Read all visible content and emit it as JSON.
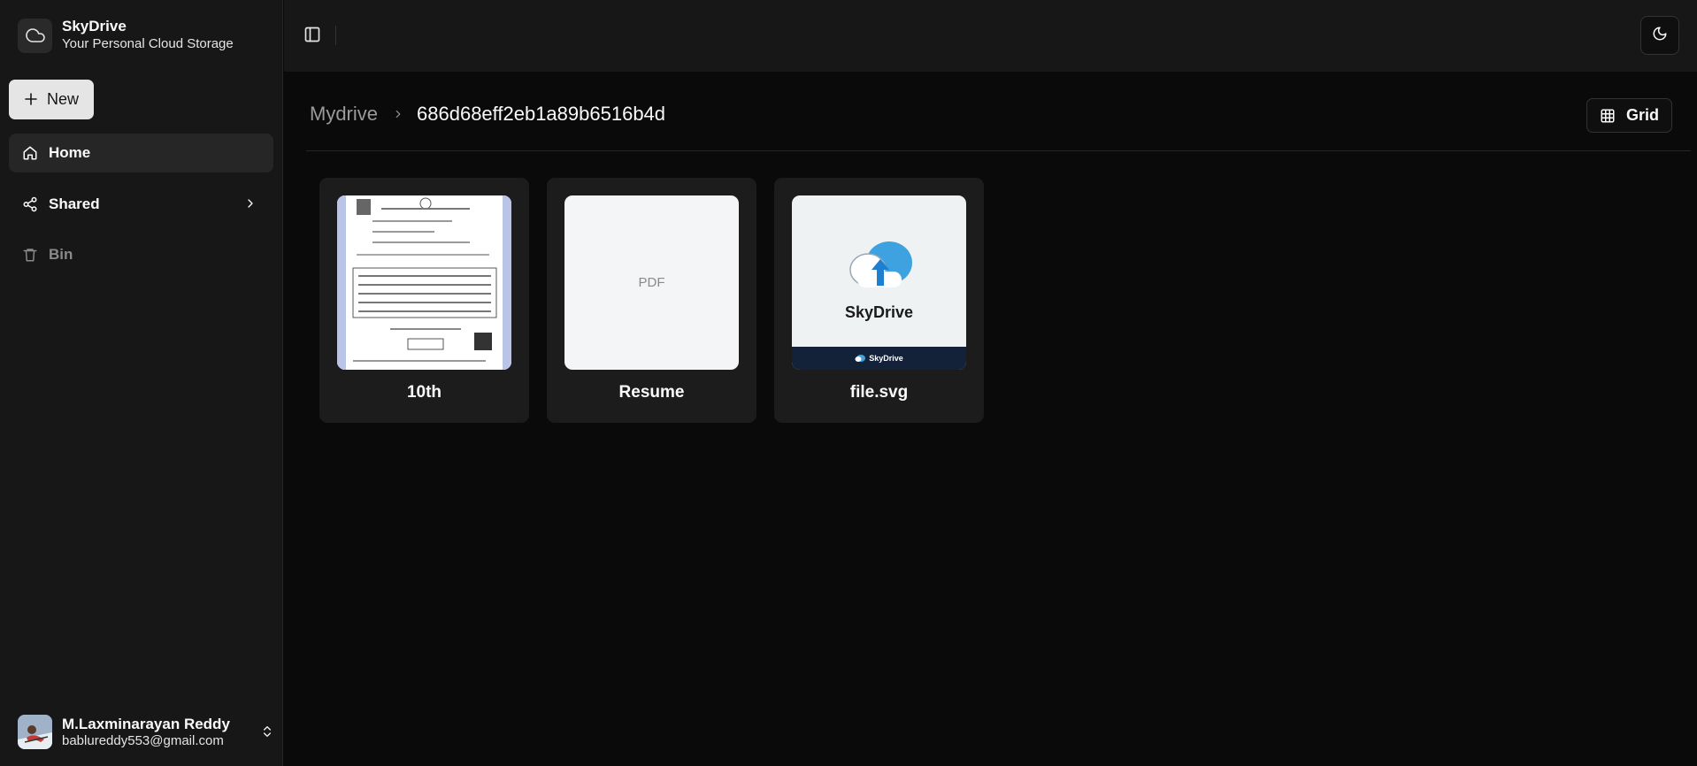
{
  "brand": {
    "title": "SkyDrive",
    "subtitle": "Your Personal Cloud Storage",
    "icon": "cloud-icon"
  },
  "sidebar": {
    "new_label": "New",
    "items": [
      {
        "label": "Home",
        "icon": "home-icon",
        "active": true
      },
      {
        "label": "Shared",
        "icon": "share-icon",
        "active": false
      },
      {
        "label": "Bin",
        "icon": "trash-icon",
        "active": false
      }
    ]
  },
  "user": {
    "name": "M.Laxminarayan Reddy",
    "email": "bablureddy553@gmail.com"
  },
  "breadcrumb": {
    "root": "Mydrive",
    "current": "686d68eff2eb1a89b6516b4d"
  },
  "view": {
    "label": "Grid"
  },
  "files": [
    {
      "name": "10th",
      "kind": "image"
    },
    {
      "name": "Resume",
      "kind": "pdf",
      "placeholder": "PDF"
    },
    {
      "name": "file.svg",
      "kind": "svg",
      "brand_text": "SkyDrive",
      "footer_text": "SkyDrive"
    }
  ],
  "colors": {
    "background": "#0a0a0a",
    "sidebar": "#171717",
    "card": "#1c1c1c",
    "accent_light": "#e5e5e5"
  }
}
